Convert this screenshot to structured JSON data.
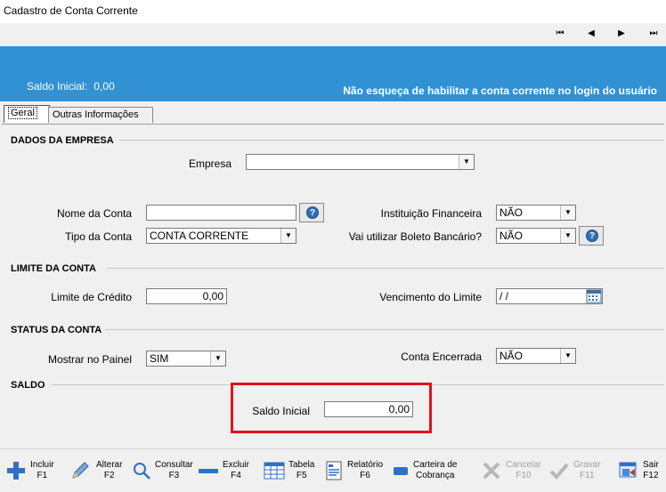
{
  "window": {
    "title": "Cadastro de Conta Corrente"
  },
  "nav": {
    "first": "⏮",
    "prev": "◀",
    "next": "▶",
    "last": "⏭"
  },
  "banner": {
    "saldo_label": "Saldo Inicial:",
    "saldo_value": "0,00",
    "warning": "Não esqueça de habilitar a conta corrente no login do usuário",
    "color": "#3191d3"
  },
  "tabs": [
    {
      "label": "Geral",
      "active": true
    },
    {
      "label": "Outras Informações",
      "active": false
    }
  ],
  "sections": {
    "empresa": "DADOS DA EMPRESA",
    "limite": "LIMITE DA CONTA",
    "status": "STATUS DA CONTA",
    "saldo": "SALDO"
  },
  "form": {
    "empresa_label": "Empresa",
    "empresa_value": "",
    "nome_conta_label": "Nome da Conta",
    "nome_conta_value": "",
    "tipo_conta_label": "Tipo da Conta",
    "tipo_conta_value": "CONTA CORRENTE",
    "instituicao_label": "Instituição Financeira",
    "instituicao_value": "NÃO",
    "boleto_label": "Vai utilizar Boleto Bancário?",
    "boleto_value": "NÃO",
    "limite_credito_label": "Limite de Crédito",
    "limite_credito_value": "0,00",
    "vencimento_label": "Vencimento do Limite",
    "vencimento_value": " / /",
    "mostrar_painel_label": "Mostrar no Painel",
    "mostrar_painel_value": "SIM",
    "conta_encerrada_label": "Conta Encerrada",
    "conta_encerrada_value": "NÃO",
    "saldo_inicial_label": "Saldo Inicial",
    "saldo_inicial_value": "0,00"
  },
  "toolbar": {
    "incluir": {
      "line1": "Incluir",
      "line2": "F1"
    },
    "alterar": {
      "line1": "Alterar",
      "line2": "F2"
    },
    "consultar": {
      "line1": "Consultar",
      "line2": "F3"
    },
    "excluir": {
      "line1": "Excluir",
      "line2": "F4"
    },
    "tabela": {
      "line1": "Tabela",
      "line2": "F5"
    },
    "relatorio": {
      "line1": "Relatório",
      "line2": "F6"
    },
    "carteira": {
      "line1": "Carteira de",
      "line2": "Cobrança"
    },
    "cancelar": {
      "line1": "Cancelar",
      "line2": "F10"
    },
    "gravar": {
      "line1": "Gravar",
      "line2": "F11"
    },
    "sair": {
      "line1": "Sair",
      "line2": "F12"
    }
  },
  "highlight_color": "#e0121b"
}
